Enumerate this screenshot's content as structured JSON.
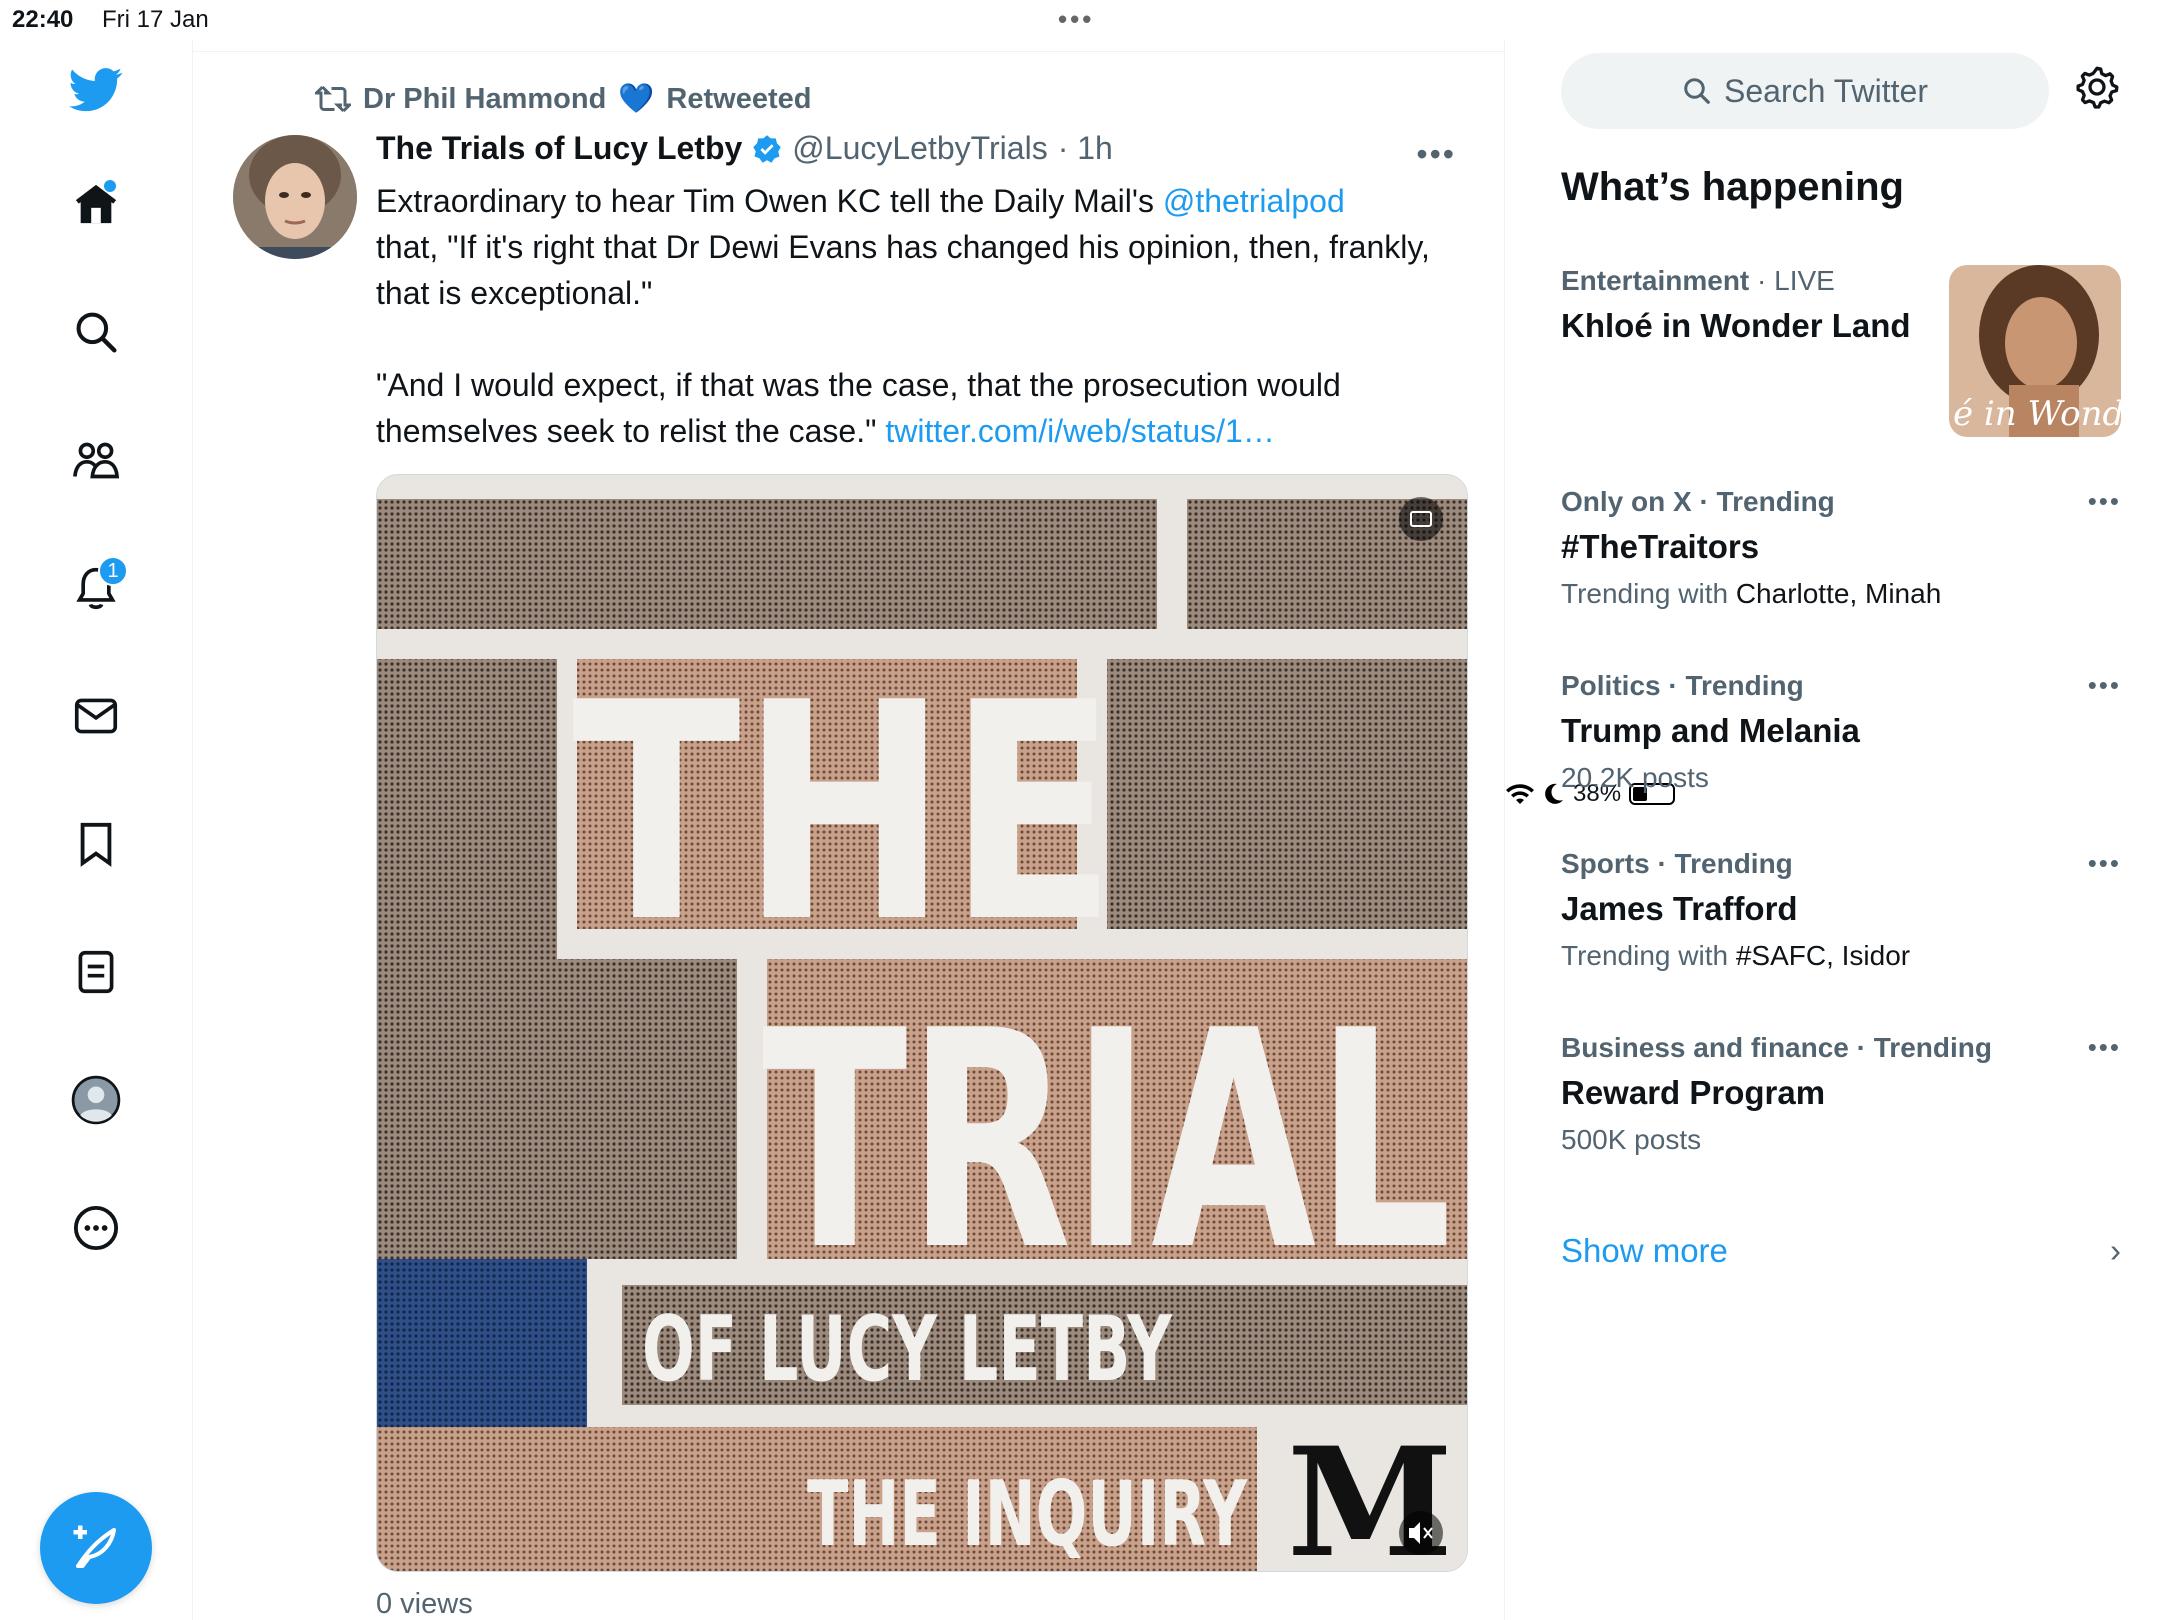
{
  "status_bar": {
    "time": "22:40",
    "date": "Fri 17 Jan",
    "battery": "38%"
  },
  "nav": {
    "notifications_count": "1"
  },
  "tweet": {
    "retweeter": "Dr Phil Hammond",
    "retweeter_emoji": "💙",
    "retweeted_label": "Retweeted",
    "author_name": "The Trials of Lucy Letby",
    "author_handle": "@LucyLetbyTrials",
    "time": "· 1h",
    "text_line1_prefix": "Extraordinary to hear Tim Owen KC tell the Daily Mail's ",
    "mention": "@thetrialpod",
    "text_line1_rest": "that, \"If it's right that Dr Dewi Evans has changed his opinion, then, frankly, that is exceptional.\"",
    "text_para2": "\"And I would expect, if that was the case, that the prosecution would themselves seek to relist the case.\" ",
    "link": "twitter.com/i/web/status/1…",
    "media": {
      "title_line1": "THE",
      "title_line2": "TRIAL",
      "subtitle": "OF LUCY LETBY",
      "series": "THE INQUIRY",
      "logo": "M"
    },
    "views": "0 views"
  },
  "sidebar": {
    "search_placeholder": "Search Twitter",
    "heading": "What’s happening",
    "trends": [
      {
        "category": "Entertainment",
        "meta_suffix": " · LIVE",
        "title": "Khloé in Wonder Land",
        "image_text": "é in Wonder L"
      },
      {
        "category": "Only on X · Trending",
        "title": "#TheTraitors",
        "sub_prefix": "Trending with ",
        "sub_with": "Charlotte, Minah"
      },
      {
        "category": "Politics · Trending",
        "title": "Trump and Melania",
        "sub": "20.2K posts"
      },
      {
        "category": "Sports · Trending",
        "title": "James Trafford",
        "sub_prefix": "Trending with ",
        "sub_with": "#SAFC, Isidor"
      },
      {
        "category": "Business and finance · Trending",
        "title": "Reward Program",
        "sub": "500K posts"
      }
    ],
    "show_more": "Show more"
  },
  "colors": {
    "accent": "#1d9bf0",
    "muted": "#536471",
    "text": "#0f1419"
  }
}
